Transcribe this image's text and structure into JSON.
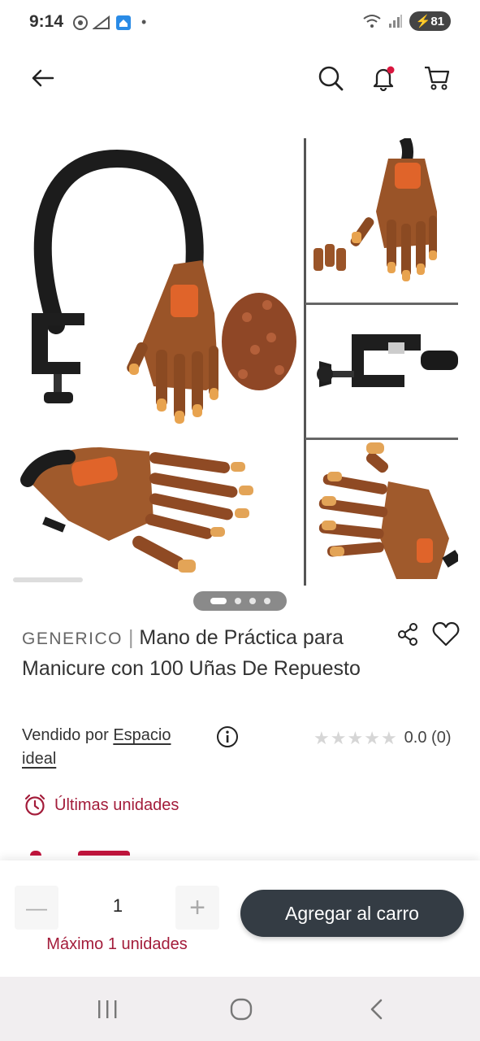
{
  "status_bar": {
    "time": "9:14",
    "battery": "81",
    "dot": "•"
  },
  "header": {
    "icons": [
      "back-arrow-icon",
      "search-icon",
      "bell-icon",
      "cart-icon"
    ],
    "notification_color": "#d9163e"
  },
  "gallery": {
    "total_images": 4,
    "active_index": 0
  },
  "product": {
    "brand": "GENERICO",
    "separator": "|",
    "title": "Mano de Práctica para Manicure con 100 Uñas De Repuesto",
    "seller_prefix": "Vendido por ",
    "seller_name": "Espacio ideal",
    "rating_value": "0.0",
    "rating_count": "(0)",
    "stars": [
      "★",
      "★",
      "★",
      "★",
      "★"
    ],
    "stock_label": "Últimas unidades"
  },
  "purchase": {
    "minus": "—",
    "quantity": "1",
    "plus": "+",
    "max_label": "Máximo 1 unidades",
    "add_to_cart": "Agregar al carro"
  },
  "colors": {
    "accent": "#a31c3a",
    "button_dark": "#343c44",
    "star_empty": "#d6d6d6"
  }
}
